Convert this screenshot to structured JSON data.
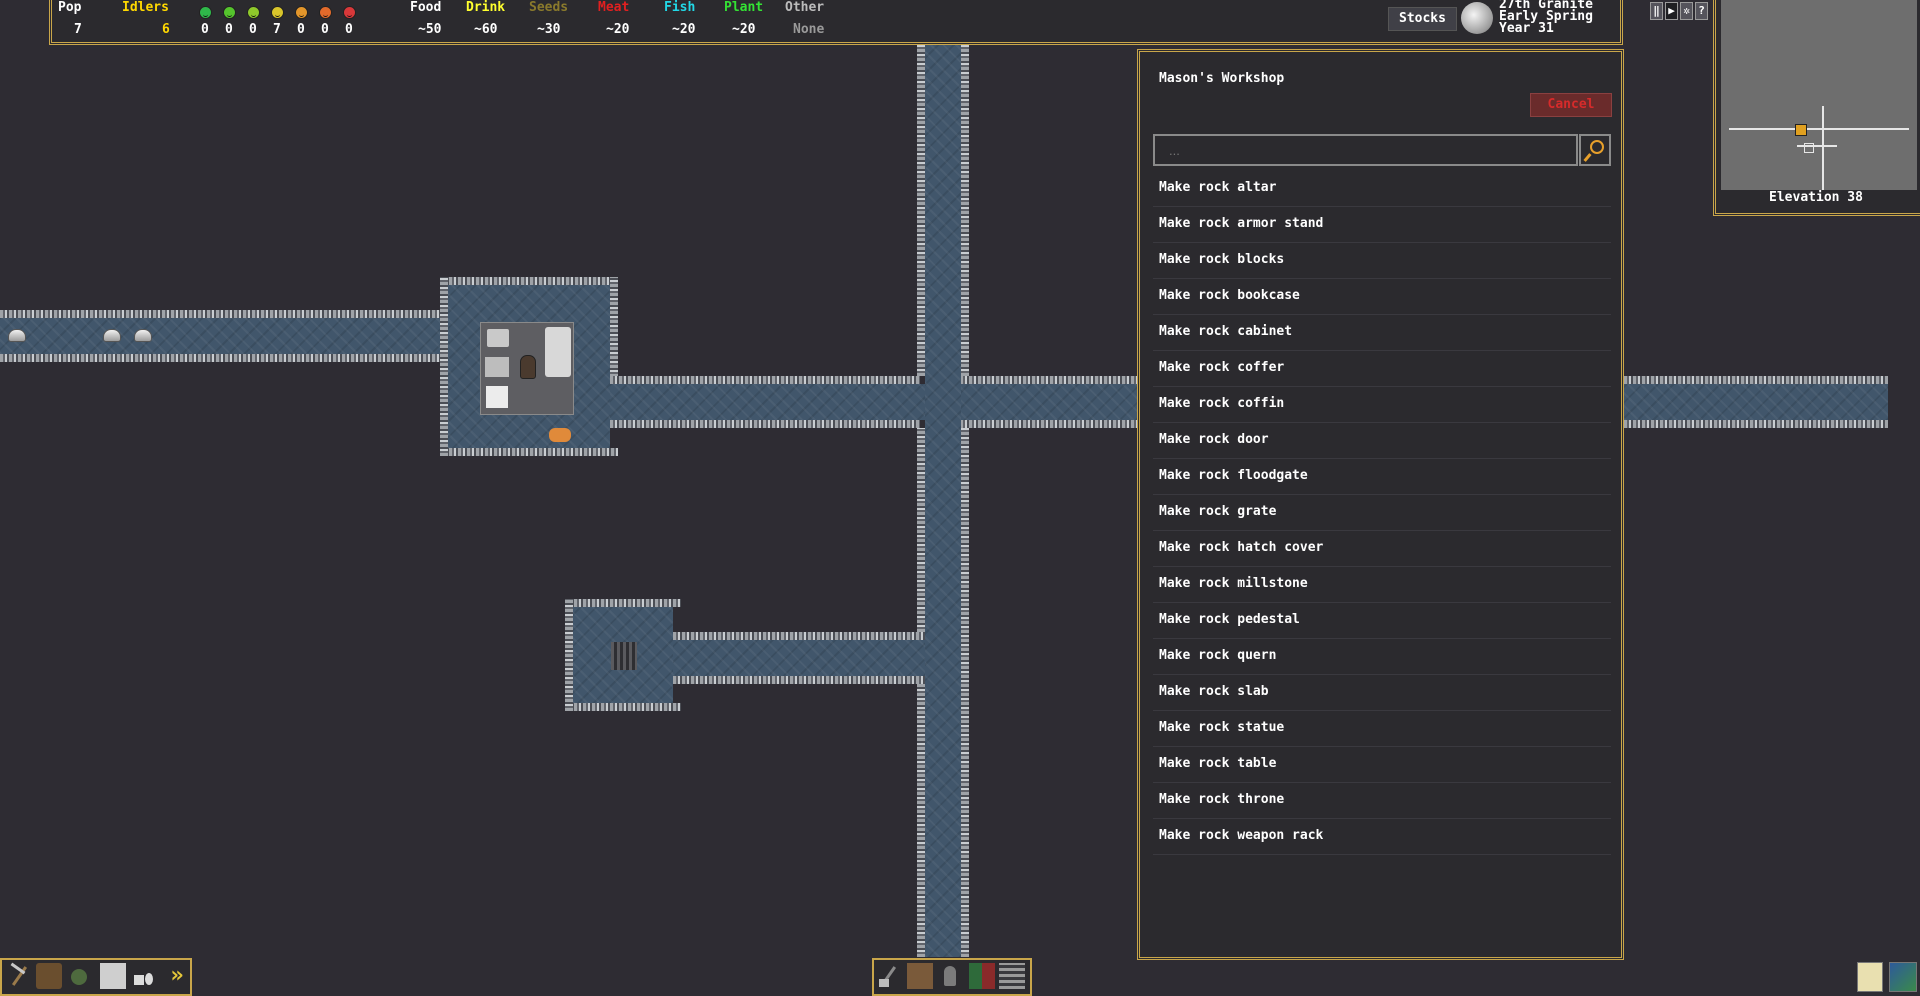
{
  "topbar": {
    "pop_label": "Pop",
    "pop_value": "7",
    "idlers_label": "Idlers",
    "idlers_value": "6",
    "moods": [
      {
        "color": "#2fb84a",
        "value": "0"
      },
      {
        "color": "#55c42d",
        "value": "0"
      },
      {
        "color": "#8fc92b",
        "value": "0"
      },
      {
        "color": "#d9c52b",
        "value": "7"
      },
      {
        "color": "#e3962b",
        "value": "0"
      },
      {
        "color": "#e26a2b",
        "value": "0"
      },
      {
        "color": "#d8383a",
        "value": "0"
      }
    ],
    "resources": [
      {
        "label": "Food",
        "value": "~50",
        "color": "#ffffff"
      },
      {
        "label": "Drink",
        "value": "~60",
        "color": "#ffff2e"
      },
      {
        "label": "Seeds",
        "value": "~30",
        "color": "#8a7a2c"
      },
      {
        "label": "Meat",
        "value": "~20",
        "color": "#e02020"
      },
      {
        "label": "Fish",
        "value": "~20",
        "color": "#22d8e6"
      },
      {
        "label": "Plant",
        "value": "~20",
        "color": "#34e234"
      },
      {
        "label": "Other",
        "value": "None",
        "color": "#bcbcbc"
      }
    ],
    "stocks_label": "Stocks",
    "date_line1": "27th Granite",
    "date_line2": "Early Spring",
    "date_line3": "Year 31"
  },
  "top_buttons": [
    "‖",
    "▶",
    "✲",
    "?"
  ],
  "minimap": {
    "elevation_label": "Elevation 38"
  },
  "panel": {
    "title": "Mason's Workshop",
    "cancel_label": "Cancel",
    "search_placeholder": "...",
    "recipes": [
      "Make rock altar",
      "Make rock armor stand",
      "Make rock blocks",
      "Make rock bookcase",
      "Make rock cabinet",
      "Make rock coffer",
      "Make rock coffin",
      "Make rock door",
      "Make rock floodgate",
      "Make rock grate",
      "Make rock hatch cover",
      "Make rock millstone",
      "Make rock pedestal",
      "Make rock quern",
      "Make rock slab",
      "Make rock statue",
      "Make rock table",
      "Make rock throne",
      "Make rock weapon rack"
    ]
  },
  "colors": {
    "gold_border": "#c9a64a",
    "panel_bg": "#2b2a2e",
    "map_bg": "#2e2c33",
    "floor": "#41566b",
    "idlers_value": "#ffd800",
    "cancel_text": "#d62b2b"
  },
  "icons": {
    "left_toolbar": [
      "pickaxe-icon",
      "chop-trees-icon",
      "gather-plants-icon",
      "smooth-stone-icon",
      "lock-icon",
      "more-icon"
    ],
    "center_toolbar": [
      "build-icon",
      "workshop-icon",
      "citizens-icon",
      "zones-icon",
      "stockpile-icon"
    ],
    "right_toolbar": [
      "notes-icon",
      "world-map-icon"
    ]
  }
}
